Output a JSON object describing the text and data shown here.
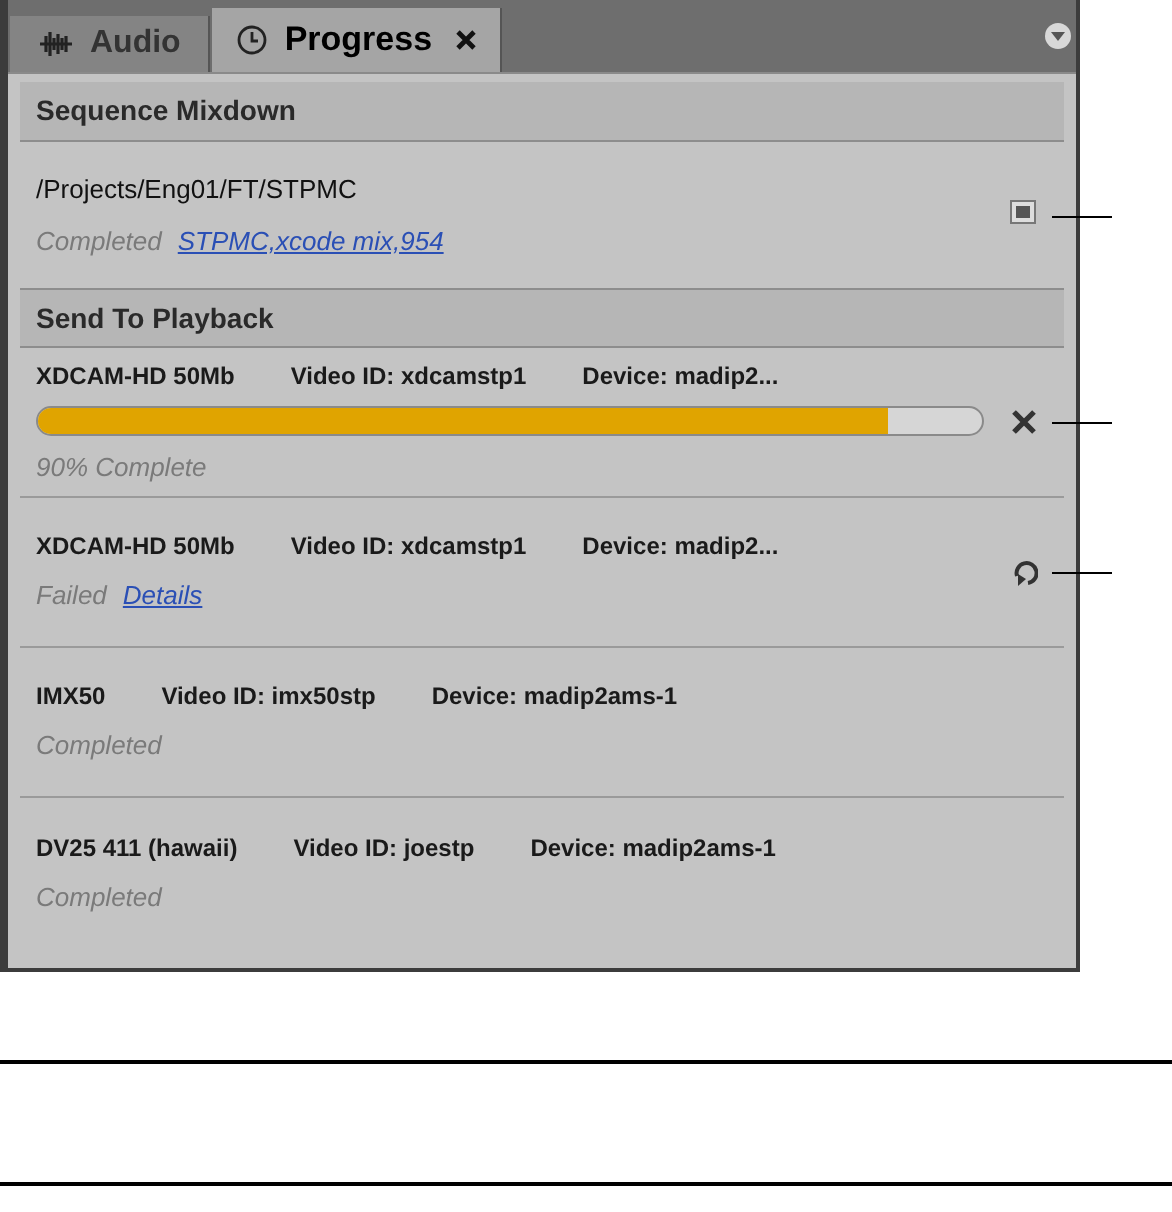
{
  "tabs": [
    {
      "label": "Audio",
      "selected": false
    },
    {
      "label": "Progress",
      "selected": true
    }
  ],
  "sections": [
    {
      "title": "Sequence Mixdown",
      "jobs": [
        {
          "kind": "mixdown",
          "path": "/Projects/Eng01/FT/STPMC",
          "status": "Completed",
          "link": "STPMC,xcode mix,954"
        }
      ]
    },
    {
      "title": "Send To Playback",
      "jobs": [
        {
          "kind": "running",
          "format": "XDCAM-HD 50Mb",
          "video_id": "Video ID: xdcamstp1",
          "device": "Device: madip2...",
          "level": 0.9,
          "status": "90% Complete"
        },
        {
          "kind": "failed",
          "format": "XDCAM-HD 50Mb",
          "video_id": "Video ID: xdcamstp1",
          "device": "Device: madip2...",
          "status": "Failed",
          "link": "Details"
        },
        {
          "kind": "done",
          "format": "IMX50",
          "video_id": "Video ID: imx50stp",
          "device": "Device: madip2ams-1",
          "status": "Completed"
        },
        {
          "kind": "done",
          "format": "DV25 411 (hawaii)",
          "video_id": "Video ID: joestp",
          "device": "Device: madip2ams-1",
          "status": "Completed"
        }
      ]
    }
  ]
}
